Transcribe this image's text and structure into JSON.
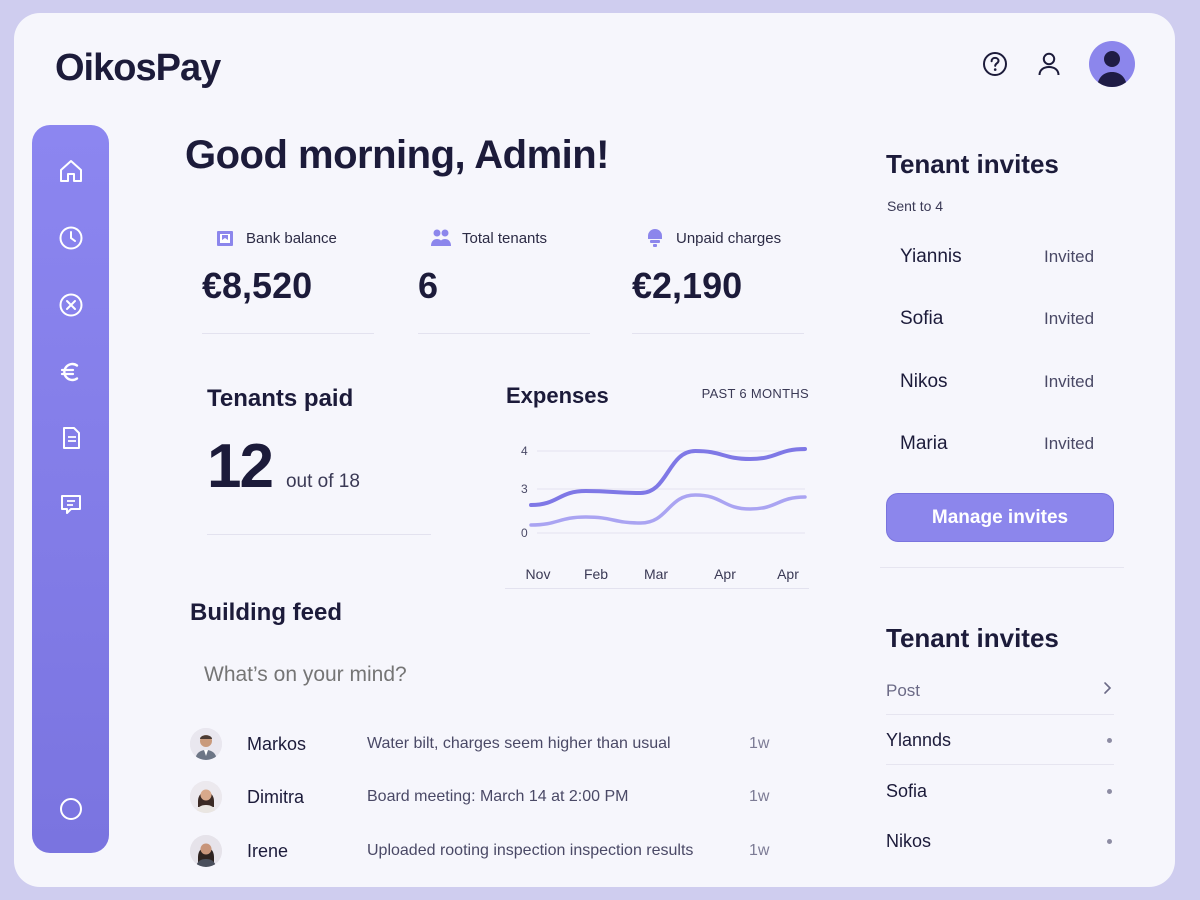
{
  "app": {
    "logo": "OikosPay"
  },
  "header": {
    "help_icon": "question-circle-icon",
    "profile_icon": "user-icon",
    "avatar": "avatar"
  },
  "sidebar": {
    "items": [
      {
        "icon": "home-icon"
      },
      {
        "icon": "clock-icon"
      },
      {
        "icon": "x-circle-icon"
      },
      {
        "icon": "euro-icon"
      },
      {
        "icon": "document-icon"
      },
      {
        "icon": "chat-icon"
      },
      {
        "icon": "circle-icon"
      }
    ]
  },
  "main": {
    "greeting": "Good morning, Admin!",
    "stats": [
      {
        "label": "Bank balance",
        "value": "€8,520",
        "icon": "bank-icon"
      },
      {
        "label": "Total tenants",
        "value": "6",
        "icon": "people-icon"
      },
      {
        "label": "Unpaid charges",
        "value": "€2,190",
        "icon": "alert-icon"
      }
    ],
    "tenants_paid": {
      "title": "Tenants paid",
      "paid": "12",
      "total_text": "out of 18"
    },
    "expenses": {
      "title": "Expenses",
      "range": "PAST 6 MONTHS"
    }
  },
  "chart_data": {
    "type": "line",
    "title": "Expenses",
    "x": [
      "Nov",
      "Feb",
      "Mar",
      "Apr",
      "Apr"
    ],
    "y_ticks": [
      "4",
      "3",
      "0"
    ],
    "series": [
      {
        "values": [
          1.2,
          1.9,
          1.8,
          3.9,
          3.5,
          4.0
        ],
        "color": "#7f78e6"
      },
      {
        "values": [
          0.2,
          0.6,
          0.3,
          1.7,
          1.0,
          1.6
        ],
        "color": "#aaa4f2"
      }
    ],
    "grid": true
  },
  "feed": {
    "title": "Building feed",
    "placeholder": "What’s on your mind?",
    "posts": [
      {
        "name": "Markos",
        "message": "Water bilt, charges seem higher than usual",
        "time": "1w"
      },
      {
        "name": "Dimitra",
        "message": "Board meeting: March 14 at 2:00 PM",
        "time": "1w"
      },
      {
        "name": "Irene",
        "message": "Uploaded rooting inspection inspection results",
        "time": "1w"
      }
    ]
  },
  "invites": {
    "title": "Tenant invites",
    "subtitle": "Sent to 4",
    "rows": [
      {
        "name": "Yiannis",
        "status": "Invited"
      },
      {
        "name": "Sofia",
        "status": "Invited"
      },
      {
        "name": "Nikos",
        "status": "Invited"
      },
      {
        "name": "Maria",
        "status": "Invited"
      }
    ],
    "button": "Manage invites"
  },
  "invites2": {
    "title": "Tenant invites",
    "rows": [
      {
        "label": "Post"
      },
      {
        "label": "Ylannds"
      },
      {
        "label": "Sofia"
      },
      {
        "label": "Nikos"
      }
    ]
  },
  "colors": {
    "accent": "#8c86ec",
    "accent_dark": "#7a74e0",
    "text": "#1c1b3a",
    "background": "#f6f6fc"
  }
}
